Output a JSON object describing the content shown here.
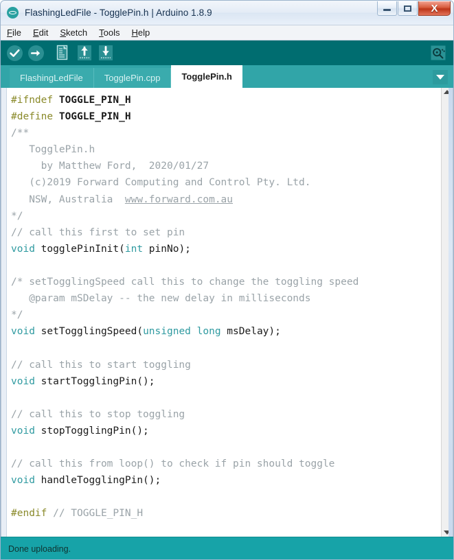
{
  "window": {
    "title": "FlashingLedFile - TogglePin.h | Arduino 1.8.9",
    "app_icon": "arduino-logo-icon",
    "controls": {
      "minimize": "minimize-icon",
      "maximize": "maximize-icon",
      "close": "X"
    }
  },
  "menubar": {
    "items": [
      {
        "accel": "F",
        "rest": "ile"
      },
      {
        "accel": "E",
        "rest": "dit"
      },
      {
        "accel": "S",
        "rest": "ketch"
      },
      {
        "accel": "T",
        "rest": "ools"
      },
      {
        "accel": "H",
        "rest": "elp"
      }
    ]
  },
  "toolbar": {
    "buttons": [
      {
        "name": "verify-button",
        "icon": "check-circle-icon",
        "tooltip": "Verify"
      },
      {
        "name": "upload-button",
        "icon": "arrow-right-circle-icon",
        "tooltip": "Upload"
      },
      {
        "name": "new-button",
        "icon": "new-file-icon",
        "tooltip": "New"
      },
      {
        "name": "open-button",
        "icon": "open-folder-icon",
        "tooltip": "Open"
      },
      {
        "name": "save-button",
        "icon": "save-icon",
        "tooltip": "Save"
      }
    ],
    "serial_monitor": {
      "name": "serial-monitor-button",
      "icon": "magnifier-icon",
      "tooltip": "Serial Monitor"
    },
    "background": "#006d70"
  },
  "tabs": {
    "items": [
      {
        "label": "FlashingLedFile",
        "active": false
      },
      {
        "label": "TogglePin.cpp",
        "active": false
      },
      {
        "label": "TogglePin.h",
        "active": true
      }
    ],
    "menu_icon": "chevron-down-icon",
    "bar_color": "#31a5a8"
  },
  "editor": {
    "language": "c-header",
    "lines": [
      [
        {
          "t": "#ifndef ",
          "c": "pre"
        },
        {
          "t": "TOGGLE_PIN_H",
          "c": "bold"
        }
      ],
      [
        {
          "t": "#define ",
          "c": "pre"
        },
        {
          "t": "TOGGLE_PIN_H",
          "c": "bold"
        }
      ],
      [
        {
          "t": "/**",
          "c": "cm"
        }
      ],
      [
        {
          "t": "   TogglePin.h",
          "c": "cm"
        }
      ],
      [
        {
          "t": "     by Matthew Ford,  2020/01/27",
          "c": "cm"
        }
      ],
      [
        {
          "t": "   (c)2019 Forward Computing and Control Pty. Ltd.",
          "c": "cm"
        }
      ],
      [
        {
          "t": "   NSW, Australia  ",
          "c": "cm"
        },
        {
          "t": "www.forward.com.au",
          "c": "cm-link"
        }
      ],
      [
        {
          "t": "*/",
          "c": "cm"
        }
      ],
      [
        {
          "t": "// call this first to set pin",
          "c": "cm"
        }
      ],
      [
        {
          "t": "void",
          "c": "kw"
        },
        {
          "t": " togglePinInit(",
          "c": "id"
        },
        {
          "t": "int",
          "c": "kw"
        },
        {
          "t": " pinNo);",
          "c": "id"
        }
      ],
      [
        {
          "t": "",
          "c": "id"
        }
      ],
      [
        {
          "t": "/* setTogglingSpeed call this to change the toggling speed",
          "c": "cm"
        }
      ],
      [
        {
          "t": "   @param mSDelay -- the new delay in milliseconds",
          "c": "cm"
        }
      ],
      [
        {
          "t": "*/",
          "c": "cm"
        }
      ],
      [
        {
          "t": "void",
          "c": "kw"
        },
        {
          "t": " setTogglingSpeed(",
          "c": "id"
        },
        {
          "t": "unsigned",
          "c": "kw"
        },
        {
          "t": " ",
          "c": "id"
        },
        {
          "t": "long",
          "c": "kw"
        },
        {
          "t": " msDelay);",
          "c": "id"
        }
      ],
      [
        {
          "t": "",
          "c": "id"
        }
      ],
      [
        {
          "t": "// call this to start toggling",
          "c": "cm"
        }
      ],
      [
        {
          "t": "void",
          "c": "kw"
        },
        {
          "t": " startTogglingPin();",
          "c": "id"
        }
      ],
      [
        {
          "t": "",
          "c": "id"
        }
      ],
      [
        {
          "t": "// call this to stop toggling",
          "c": "cm"
        }
      ],
      [
        {
          "t": "void",
          "c": "kw"
        },
        {
          "t": " stopTogglingPin();",
          "c": "id"
        }
      ],
      [
        {
          "t": "",
          "c": "id"
        }
      ],
      [
        {
          "t": "// call this from loop() to check if pin should toggle",
          "c": "cm"
        }
      ],
      [
        {
          "t": "void",
          "c": "kw"
        },
        {
          "t": " handleTogglingPin();",
          "c": "id"
        }
      ],
      [
        {
          "t": "",
          "c": "id"
        }
      ],
      [
        {
          "t": "#endif",
          "c": "pre"
        },
        {
          "t": " // TOGGLE_PIN_H",
          "c": "cm"
        }
      ]
    ],
    "colors": {
      "comment": "#9aa3a8",
      "preprocessor": "#8a8a2a",
      "keyword": "#2f9aa0",
      "identifier": "#1a1a1a",
      "background": "#ffffff"
    }
  },
  "scrollbar": {
    "up_icon": "scroll-up-arrow-icon",
    "down_icon": "scroll-down-arrow-icon"
  },
  "statusbar": {
    "message": "Done uploading.",
    "background": "#17a3a8"
  }
}
